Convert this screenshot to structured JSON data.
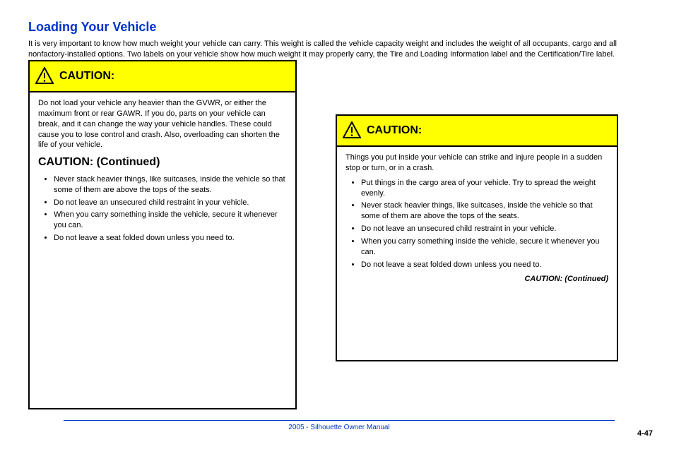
{
  "section_title": "Loading Your Vehicle",
  "intro": "It is very important to know how much weight your vehicle can carry. This weight is called the vehicle capacity weight and includes the weight of all occupants, cargo and all nonfactory-installed options. Two labels on your vehicle show how much weight it may properly carry, the Tire and Loading Information label and the Certification/Tire label.",
  "box_left": {
    "caution_label": "CAUTION:",
    "paragraph": "Do not load your vehicle any heavier than the GVWR, or either the maximum front or rear GAWR. If you do, parts on your vehicle can break, and it can change the way your vehicle handles. These could cause you to lose control and crash. Also, overloading can shorten the life of your vehicle.",
    "continue_label": "CAUTION: (Continued)",
    "bullets": [
      "Never stack heavier things, like suitcases, inside the vehicle so that some of them are above the tops of the seats.",
      "Do not leave an unsecured child restraint in your vehicle.",
      "When you carry something inside the vehicle, secure it whenever you can.",
      "Do not leave a seat folded down unless you need to."
    ]
  },
  "box_right": {
    "caution_label": "CAUTION:",
    "paragraph": "Things you put inside your vehicle can strike and injure people in a sudden stop or turn, or in a crash.",
    "bullets": [
      "Put things in the cargo area of your vehicle. Try to spread the weight evenly.",
      "Never stack heavier things, like suitcases, inside the vehicle so that some of them are above the tops of the seats.",
      "Do not leave an unsecured child restraint in your vehicle.",
      "When you carry something inside the vehicle, secure it whenever you can.",
      "Do not leave a seat folded down unless you need to."
    ],
    "continued": "CAUTION: (Continued)"
  },
  "footnote": "2005 - Silhouette Owner Manual",
  "page_number": "4-47"
}
